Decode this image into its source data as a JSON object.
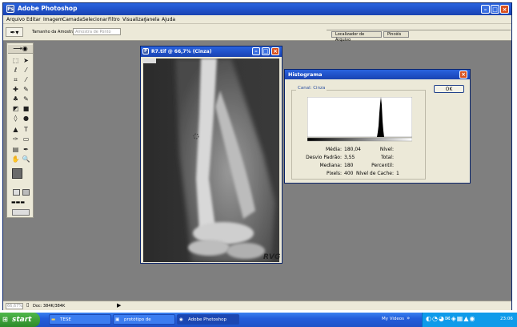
{
  "app": {
    "title": "Adobe Photoshop",
    "menu": [
      "Arquivo",
      "Editar",
      "Imagem",
      "Camada",
      "Selecionar",
      "Filtro",
      "Visualizar",
      "Janela",
      "Ajuda"
    ],
    "options": {
      "sample_label": "Tamanho da Amostra:",
      "sample_value": "Amostra de Ponto"
    },
    "palette_tabs": [
      "Localizador de Arquivo",
      "Pincéis"
    ],
    "status": {
      "zoom": "66,67%",
      "doc": "Doc: 384K/384K"
    }
  },
  "document": {
    "title": "R7.tif @ 66,7% (Cinza)",
    "watermark": "RVG"
  },
  "histogram": {
    "title": "Histograma",
    "channel_label": "Canal:",
    "channel_value": "Cinza",
    "ok_label": "OK",
    "stats": {
      "media_label": "Média:",
      "media": "180,04",
      "desvio_label": "Desvio Padrão:",
      "desvio": "3,55",
      "mediana_label": "Mediana:",
      "mediana": "180",
      "pixels_label": "Pixels:",
      "pixels": "400",
      "nivel_label": "Nível:",
      "nivel": "",
      "total_label": "Total:",
      "total": "",
      "percentil_label": "Percentil:",
      "percentil": "",
      "cache_label": "Nível de Cache:",
      "cache": "1"
    }
  },
  "taskbar": {
    "start": "start",
    "tasks": [
      "TESE",
      "protótipo de tese.doc...",
      "Adobe Photoshop"
    ],
    "my_videos": "My Videos",
    "clock": "23:06"
  },
  "colors": {
    "titlebar": "#1f4fc6",
    "close": "#d9501e",
    "dialog_bg": "#ece9d8",
    "desktop": "#7f7f7f"
  }
}
